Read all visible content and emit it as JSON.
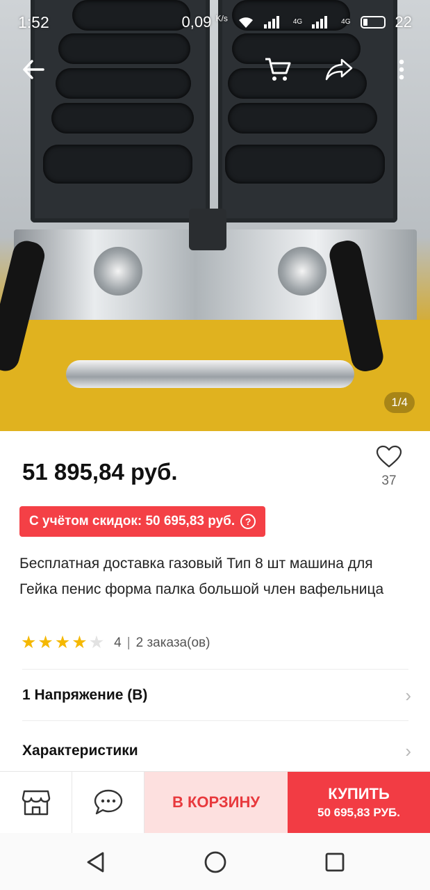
{
  "status_bar": {
    "time": "1:52",
    "network_speed": "0,09",
    "speed_unit": "K/s",
    "network_type_1": "4G",
    "network_type_2": "4G",
    "battery": "22"
  },
  "gallery": {
    "counter": "1/4",
    "image_alt": "waffle-maker-photo"
  },
  "top_bar": {
    "icons": [
      "back-arrow-icon",
      "cart-icon",
      "share-icon",
      "more-vertical-icon"
    ]
  },
  "product": {
    "price": "51 895,84 руб.",
    "wishlist_count": "37",
    "discount_label": "С учётом скидок: 50 695,83 руб.",
    "title": "Бесплатная доставка газовый Тип 8 шт машина для Гейка пенис форма палка большой член вафельница",
    "rating_value": "4",
    "rating_stars": 4,
    "rating_max": 5,
    "orders": "2 заказа(ов)"
  },
  "sections": {
    "voltage_label": "1 Напряжение (В)",
    "specs_label": "Характеристики"
  },
  "bottom_bar": {
    "add_to_cart": "В КОРЗИНУ",
    "buy": "КУПИТЬ",
    "buy_price": "50 695,83 РУБ."
  },
  "colors": {
    "accent": "#f23c44",
    "cart_bg": "#fde0df",
    "star": "#f5b800"
  }
}
